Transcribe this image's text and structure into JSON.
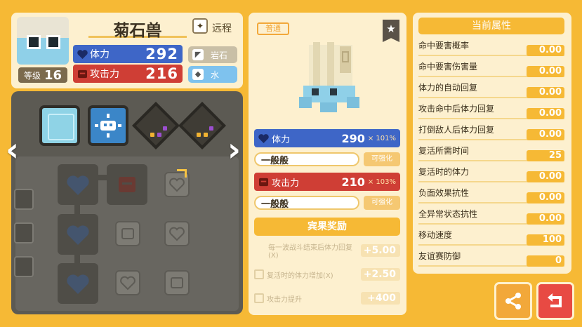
{
  "pokemon": {
    "name": "菊石兽",
    "level_label": "等级",
    "level": "16",
    "range_label": "远程",
    "hp_label": "体力",
    "hp": "292",
    "atk_label": "攻击力",
    "atk": "216",
    "types": [
      "岩石",
      "水"
    ]
  },
  "detail": {
    "rarity": "普通",
    "hp_label": "体力",
    "hp_value": "290",
    "hp_pct": "× 101%",
    "hp_potential": "一般般",
    "atk_label": "攻击力",
    "atk_value": "210",
    "atk_pct": "× 103%",
    "atk_potential": "一般般",
    "enhance_label": "可强化",
    "bonus_title": "宾果奖励",
    "bonuses": [
      {
        "text": "每一波战斗结束后体力回复(X)",
        "value": "+5.00"
      },
      {
        "text": "复活时的体力增加(X)",
        "value": "+2.50"
      },
      {
        "text": "攻击力提升",
        "value": "+400"
      }
    ]
  },
  "attributes": {
    "title": "当前属性",
    "items": [
      {
        "name": "命中要害概率",
        "value": "0.00"
      },
      {
        "name": "命中要害伤害量",
        "value": "0.00"
      },
      {
        "name": "体力的自动回复",
        "value": "0.00"
      },
      {
        "name": "攻击命中后体力回复",
        "value": "0.00"
      },
      {
        "name": "打倒敌人后体力回复",
        "value": "0.00"
      },
      {
        "name": "复活所需时间",
        "value": "25"
      },
      {
        "name": "复活时的体力",
        "value": "0.00"
      },
      {
        "name": "负面效果抗性",
        "value": "0.00"
      },
      {
        "name": "全异常状态抗性",
        "value": "0.00"
      },
      {
        "name": "移动速度",
        "value": "100"
      },
      {
        "name": "友谊赛防御",
        "value": "0"
      }
    ]
  },
  "colors": {
    "background": "#f6b935",
    "hp": "#3e66c7",
    "attack": "#cf3e35",
    "panel": "#fdf0cf"
  }
}
